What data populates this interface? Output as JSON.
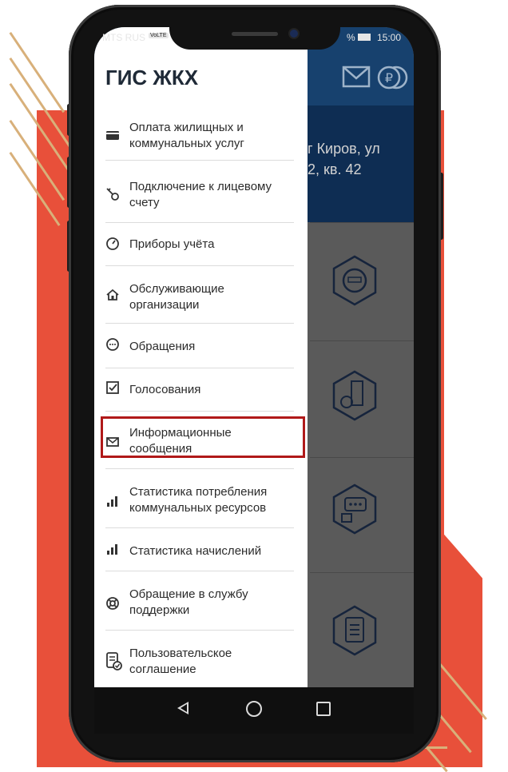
{
  "status_bar": {
    "carrier": "MTS RUS",
    "carrier_badge": "VoLTE",
    "battery_percent": "%",
    "time": "15:00"
  },
  "app": {
    "title": "ГИС ЖКХ",
    "address_line1": "г Киров, ул",
    "address_line2": "2, кв. 42"
  },
  "drawer": {
    "items": [
      {
        "label": "Оплата жилищных и коммунальных услуг",
        "icon": "card-icon"
      },
      {
        "label": "Подключение к лицевому счету",
        "icon": "key-icon"
      },
      {
        "label": "Приборы учёта",
        "icon": "gauge-icon"
      },
      {
        "label": "Обслуживающие организации",
        "icon": "home-icon"
      },
      {
        "label": "Обращения",
        "icon": "chat-icon"
      },
      {
        "label": "Голосования",
        "icon": "checkbox-icon"
      },
      {
        "label": "Информационные сообщения",
        "icon": "mail-icon"
      },
      {
        "label": "Статистика потребления коммунальных ресурсов",
        "icon": "bar-chart-icon"
      },
      {
        "label": "Статистика начислений",
        "icon": "bar-chart-icon"
      },
      {
        "label": "Обращение в службу поддержки",
        "icon": "lifebuoy-icon"
      },
      {
        "label": "Пользовательское соглашение",
        "icon": "document-check-icon"
      }
    ]
  },
  "colors": {
    "accent_red": "#e8503a",
    "header_blue": "#17416e",
    "highlight_red": "#b01919"
  }
}
